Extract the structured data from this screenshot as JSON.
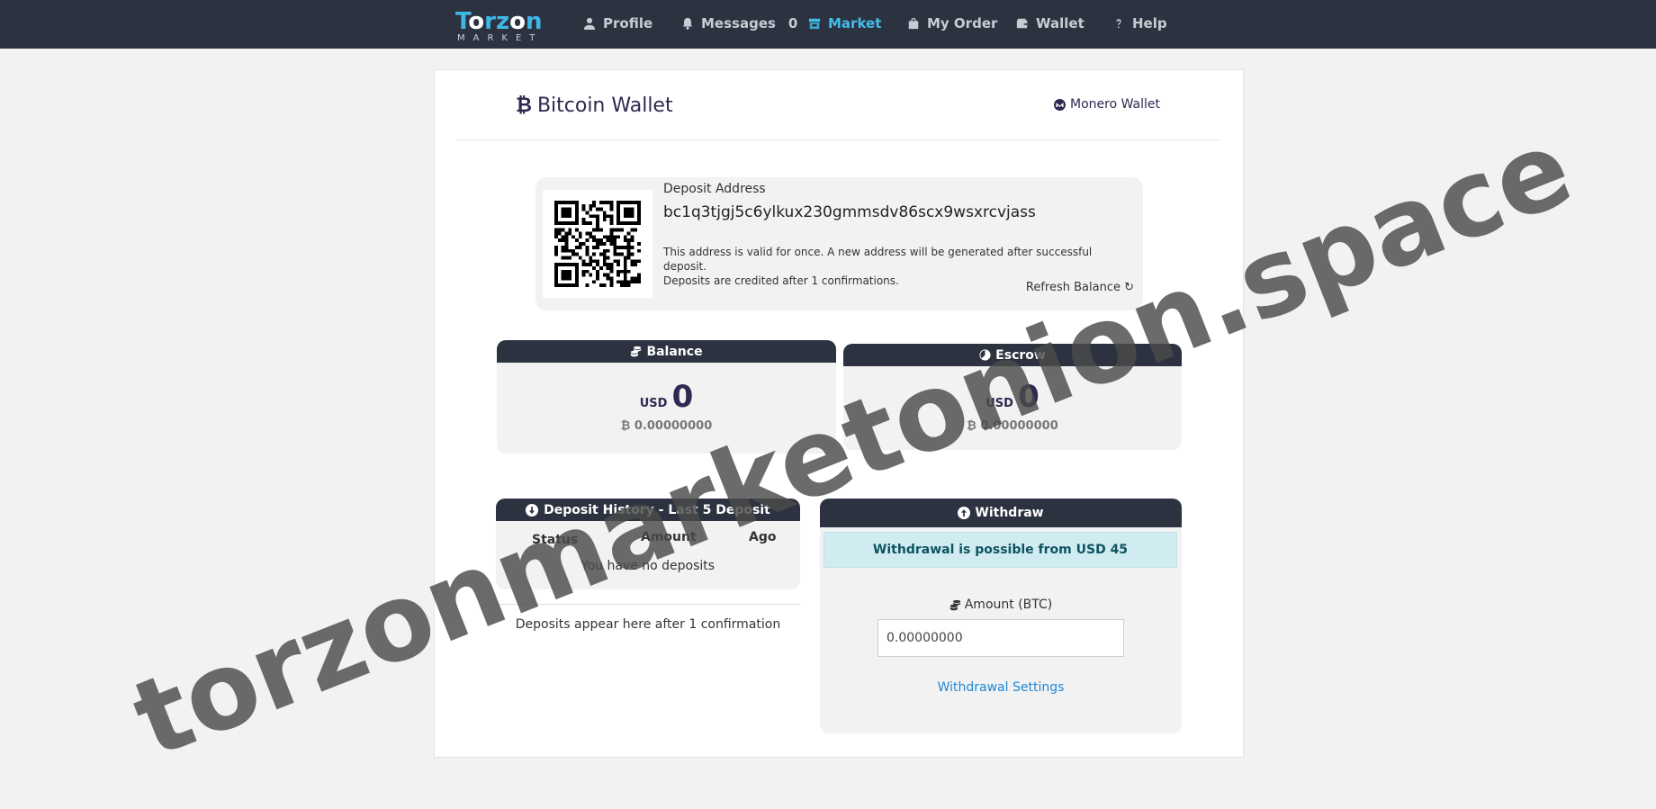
{
  "navbar": {
    "logo_top_a": "T",
    "logo_top_o": "o",
    "logo_top_b": "rz",
    "logo_top_o2": "o",
    "logo_top_c": "n",
    "logo_bottom": "MARKET",
    "items": [
      {
        "label": "Profile",
        "icon": "user-icon"
      },
      {
        "label": "Messages",
        "icon": "bell-icon",
        "badge": "0"
      },
      {
        "label": "Market",
        "icon": "store-icon",
        "active": true
      },
      {
        "label": "My Order",
        "icon": "bag-icon"
      },
      {
        "label": "Wallet",
        "icon": "wallet-icon"
      },
      {
        "label": "Help",
        "icon": "question-icon"
      }
    ],
    "accent_color": "#41bde9"
  },
  "wallet": {
    "title": "Bitcoin Wallet",
    "btc_symbol": "₿",
    "monero_link": "Monero Wallet"
  },
  "deposit": {
    "label": "Deposit Address",
    "address": "bc1q3tjgj5c6ylkux230gmmsdv86scx9wsxrcvjass",
    "note_line1": "This address is valid for once. A new address will be generated after successful deposit.",
    "note_line2": "Deposits are credited after 1 confirmations.",
    "refresh": "Refresh Balance ↻"
  },
  "balance": {
    "title": "Balance",
    "currency": "USD",
    "amount": "0",
    "btc": "₿ 0.00000000"
  },
  "escrow": {
    "title": "Escrow",
    "currency": "USD",
    "amount": "0",
    "btc": "₿ 0.00000000"
  },
  "history": {
    "title": "Deposit History - Last 5 Deposit",
    "columns": [
      "Status",
      "Amount",
      "Ago"
    ],
    "empty": "You have no deposits",
    "note": "Deposits appear here after 1 confirmation"
  },
  "withdraw": {
    "title": "Withdraw",
    "alert": "Withdrawal is possible from USD 45",
    "amount_label": "Amount (BTC)",
    "amount_value": "0.00000000",
    "settings_link": "Withdrawal Settings"
  },
  "watermark": "torzonmarketonion.space"
}
